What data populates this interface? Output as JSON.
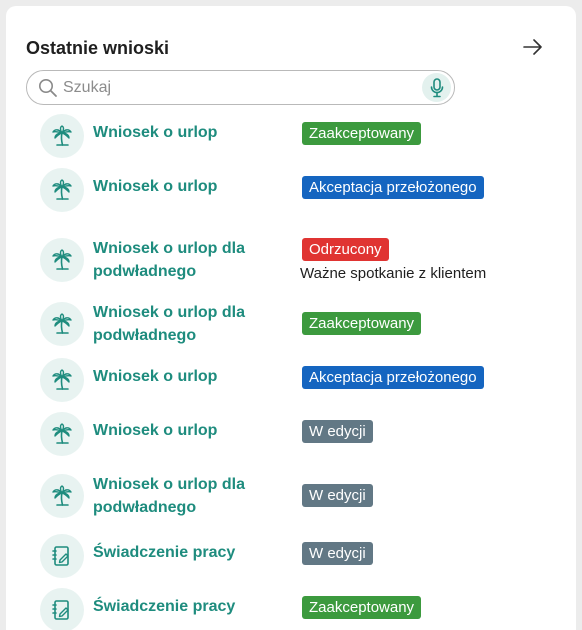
{
  "header": {
    "title": "Ostatnie wnioski",
    "arrow_icon": "arrow-right-icon"
  },
  "search": {
    "placeholder": "Szukaj",
    "value": "",
    "search_icon": "search-icon",
    "mic_icon": "microphone-icon"
  },
  "colors": {
    "accent": "#1e8c7e",
    "accepted": "#3c9a3e",
    "supervisor": "#1565c0",
    "rejected": "#e03432",
    "in_edit": "#627885",
    "icon_bg": "#e8f3f1"
  },
  "requests": [
    {
      "icon": "palm-tree-icon",
      "title": "Wniosek o urlop",
      "status": "Zaakceptowany",
      "status_kind": "accepted"
    },
    {
      "icon": "palm-tree-icon",
      "title": "Wniosek o urlop",
      "status": "Akceptacja przełożonego",
      "status_kind": "supervisor"
    },
    {
      "icon": "palm-tree-icon",
      "title": "Wniosek o urlop dla podwładnego",
      "status": "Odrzucony",
      "status_kind": "rejected",
      "note": "Ważne spotkanie z klientem"
    },
    {
      "icon": "palm-tree-icon",
      "title": "Wniosek o urlop dla podwładnego",
      "status": "Zaakceptowany",
      "status_kind": "accepted"
    },
    {
      "icon": "palm-tree-icon",
      "title": "Wniosek o urlop",
      "status": "Akceptacja przełożonego",
      "status_kind": "supervisor"
    },
    {
      "icon": "palm-tree-icon",
      "title": "Wniosek o urlop",
      "status": "W edycji",
      "status_kind": "edit"
    },
    {
      "icon": "palm-tree-icon",
      "title": "Wniosek o urlop dla podwładnego",
      "status": "W edycji",
      "status_kind": "edit"
    },
    {
      "icon": "notebook-pen-icon",
      "title": "Świadczenie pracy",
      "status": "W edycji",
      "status_kind": "edit"
    },
    {
      "icon": "notebook-pen-icon",
      "title": "Świadczenie pracy",
      "status": "Zaakceptowany",
      "status_kind": "accepted"
    }
  ]
}
